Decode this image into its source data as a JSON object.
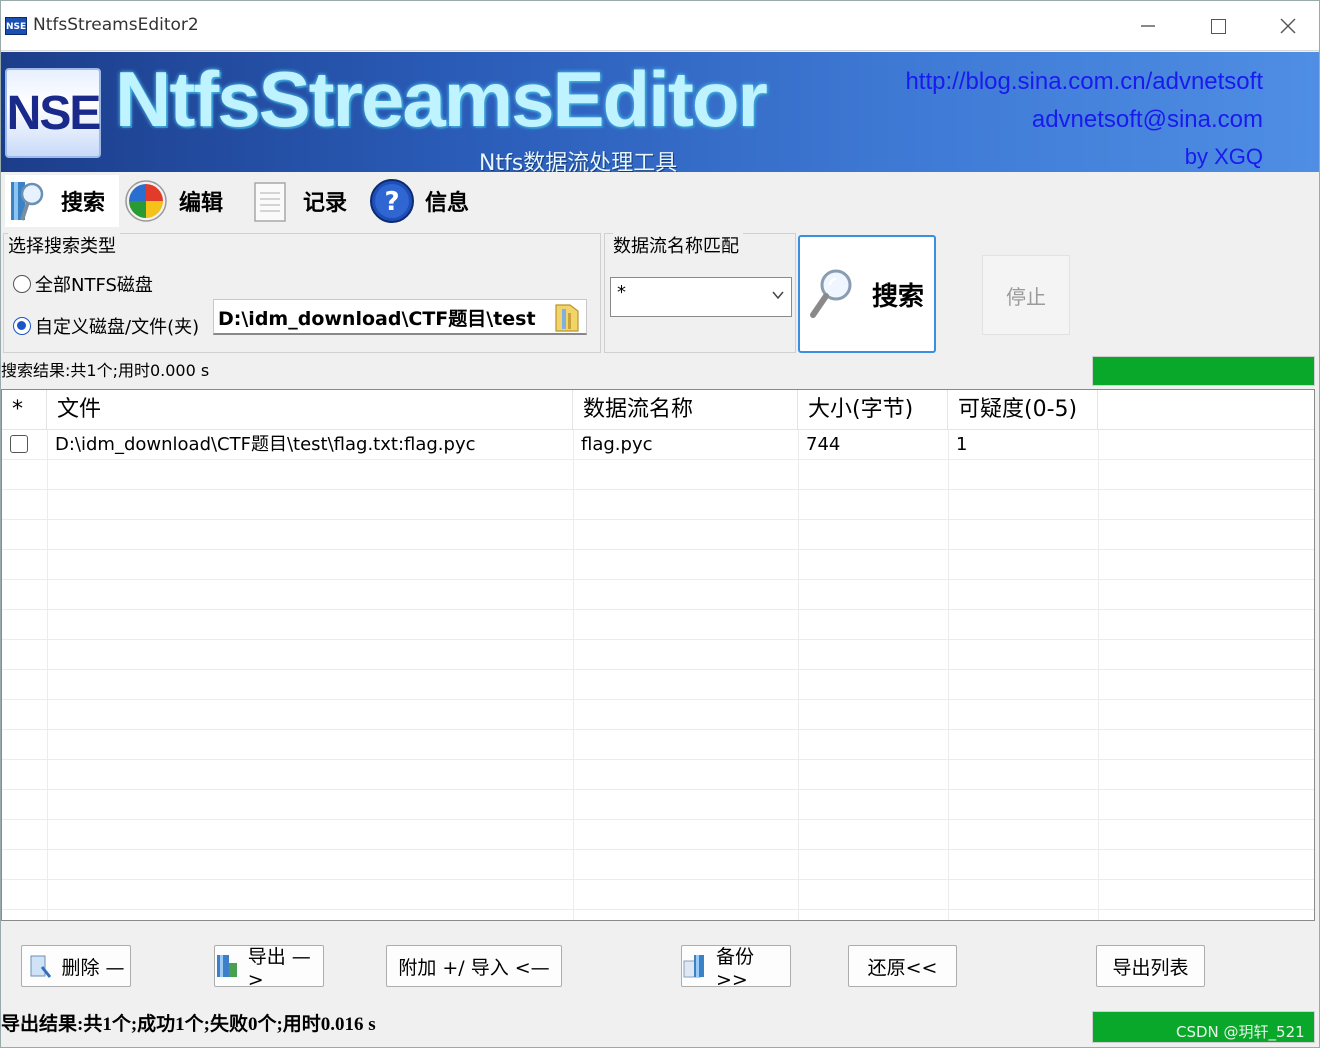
{
  "window": {
    "title": "NtfsStreamsEditor2",
    "icon_label": "NSE",
    "controls": [
      "minimize-icon",
      "maximize-icon",
      "close-icon"
    ]
  },
  "banner": {
    "logo": "NSE",
    "brand": "NtfsStreamsEditor",
    "subtitle": "Ntfs数据流处理工具",
    "link_blog": "http://blog.sina.com.cn/advnetsoft",
    "link_email": "advnetsoft@sina.com",
    "author": "by XGQ"
  },
  "tabs": [
    {
      "label": "搜索",
      "icon": "search-icon",
      "active": true
    },
    {
      "label": "编辑",
      "icon": "edit-icon",
      "active": false
    },
    {
      "label": "记录",
      "icon": "notepad-icon",
      "active": false
    },
    {
      "label": "信息",
      "icon": "help-icon",
      "active": false
    }
  ],
  "search": {
    "type_group_title": "选择搜索类型",
    "option_all": "全部NTFS磁盘",
    "option_custom": "自定义磁盘/文件(夹)",
    "selected": "custom",
    "path_value": "D:\\idm_download\\CTF题目\\test",
    "stream_group_title": "数据流名称匹配",
    "stream_pattern": "*",
    "search_button": "搜索",
    "stop_button": "停止",
    "result_status": "搜索结果:共1个;用时0.000 s",
    "progress": 1.0
  },
  "table": {
    "columns": [
      "*",
      "文件",
      "数据流名称",
      "大小(字节)",
      "可疑度(0-5)"
    ],
    "rows": [
      {
        "checked": false,
        "file": "D:\\idm_download\\CTF题目\\test\\flag.txt:flag.pyc",
        "stream": "flag.pyc",
        "size": "744",
        "suspicion": "1"
      }
    ]
  },
  "actions": {
    "delete": "删除 —",
    "export": "导出 —>",
    "append_import": "附加 +/ 导入 <—",
    "backup": "备份 >>",
    "restore": "还原<<",
    "export_list": "导出列表"
  },
  "footer": {
    "export_status": "导出结果:共1个;成功1个;失败0个;用时0.016 s",
    "progress": 1.0,
    "watermark": "CSDN @玥轩_521"
  },
  "colors": {
    "banner_start": "#1c3d8a",
    "banner_end": "#4f8ee4",
    "brand_text": "#bff3ff",
    "link": "#1a1aee",
    "progress": "#0aa82a",
    "search_border": "#3b8fe0"
  }
}
